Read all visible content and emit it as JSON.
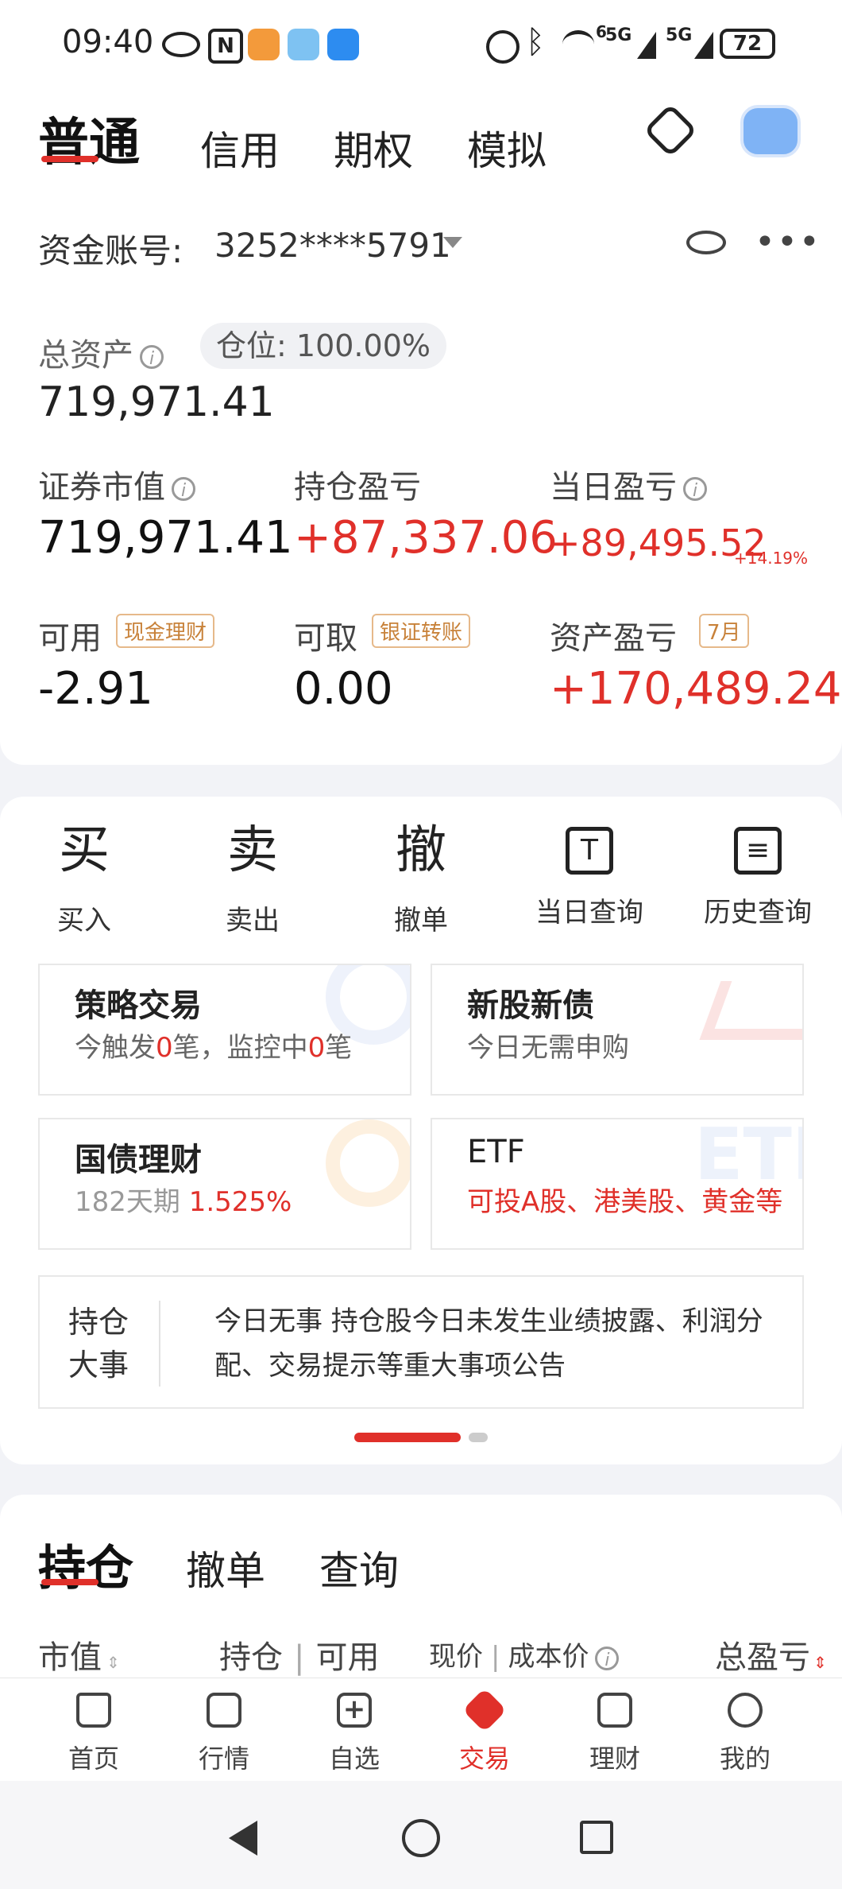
{
  "status_bar": {
    "time": "09:40",
    "battery": "72",
    "net1": "5G",
    "net2": "5G",
    "wifi_sup": "6"
  },
  "tabs": [
    "普通",
    "信用",
    "期权",
    "模拟"
  ],
  "account": {
    "label": "资金账号:",
    "number": "3252****5791"
  },
  "total_assets": {
    "label": "总资产",
    "value": "719,971.41",
    "position_label": "仓位:",
    "position_value": "100.00%"
  },
  "metrics": {
    "market_value": {
      "label": "证券市值",
      "value": "719,971.41"
    },
    "holding_pnl": {
      "label": "持仓盈亏",
      "value": "+87,337.06"
    },
    "daily_pnl": {
      "label": "当日盈亏",
      "value": "+89,495.52",
      "pct": "+14.19%"
    },
    "available": {
      "label": "可用",
      "badge": "现金理财",
      "value": "-2.91"
    },
    "withdrawable": {
      "label": "可取",
      "badge": "银证转账",
      "value": "0.00"
    },
    "asset_pnl": {
      "label": "资产盈亏",
      "badge": "7月",
      "value": "+170,489.24"
    }
  },
  "actions": [
    {
      "glyph": "买",
      "label": "买入"
    },
    {
      "glyph": "卖",
      "label": "卖出"
    },
    {
      "glyph": "撤",
      "label": "撤单"
    },
    {
      "glyph": "T",
      "label": "当日查询"
    },
    {
      "glyph": "≡",
      "label": "历史查询"
    }
  ],
  "tiles": {
    "strategy": {
      "title": "策略交易",
      "sub_a": "今触发",
      "count1": "0",
      "sub_b": "笔，监控中",
      "count2": "0",
      "sub_c": "笔"
    },
    "ipo": {
      "title": "新股新债",
      "sub": "今日无需申购"
    },
    "bond": {
      "title": "国债理财",
      "period": "182天期",
      "rate": "1.525%"
    },
    "etf": {
      "title": "ETF",
      "sub": "可投A股、港美股、黄金等"
    }
  },
  "events": {
    "title_line1": "持仓",
    "title_line2": "大事",
    "text": "今日无事 持仓股今日未发生业绩披露、利润分配、交易提示等重大事项公告"
  },
  "holdings_tabs": [
    "持仓",
    "撤单",
    "查询"
  ],
  "table_headers": {
    "col1": "市值",
    "col2a": "持仓",
    "col2b": "可用",
    "col3a": "现价",
    "col3b": "成本价",
    "col4": "总盈亏"
  },
  "nav": [
    "首页",
    "行情",
    "自选",
    "交易",
    "理财",
    "我的"
  ],
  "colors": {
    "accent": "#e0302a",
    "badge": "#c8823a"
  }
}
